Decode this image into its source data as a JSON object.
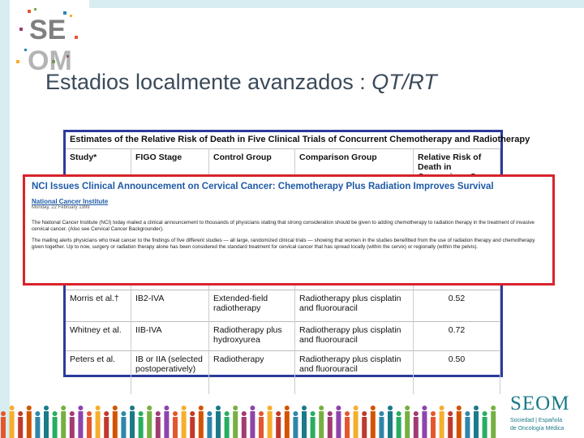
{
  "slide": {
    "title_main": "Estadios localmente avanzados : ",
    "title_italic": "QT/RT"
  },
  "logo": {
    "text": "SE OM"
  },
  "table": {
    "caption": "Estimates of the Relative Risk of Death in Five Clinical Trials of Concurrent Chemotherapy and Radiotherapy",
    "headers": [
      "Study*",
      "FIGO Stage",
      "Control Group",
      "Comparison Group",
      "Relative Risk of Death in Comparison Group"
    ],
    "rows": [
      [
        "Morris et al.†",
        "IB2-IVA",
        "Extended-field radiotherapy",
        "Radiotherapy plus cisplatin and fluorouracil",
        "0.52"
      ],
      [
        "Whitney et al.",
        "IIB-IVA",
        "Radiotherapy plus hydroxyurea",
        "Radiotherapy plus cisplatin and fluorouracil",
        "0.72"
      ],
      [
        "Peters et al.",
        "IB or IIA (selected postoperatively)",
        "Radiotherapy",
        "Radiotherapy plus cisplatin and fluorouracil",
        "0.50"
      ]
    ]
  },
  "announcement": {
    "title": "NCI Issues Clinical Announcement on Cervical Cancer: Chemotherapy Plus Radiation Improves Survival",
    "source": "National Cancer Institute",
    "date": "Monday, 22 February 1999",
    "para1": "The National Cancer Institute (NCI) today mailed a clinical announcement to thousands of physicians stating that strong consideration should be given to adding chemotherapy to radiation therapy in the treatment of invasive cervical cancer. (Also see Cervical Cancer Backgrounder).",
    "para2": "The mailing alerts physicians who treat cancer to the findings of five different studies — all large, randomized clinical trials — showing that women in the studies benefitted from the use of radiation therapy and chemotherapy given together. Up to now, surgery or radiation therapy alone has been considered the standard treatment for cervical cancer that has spread locally (within the cervix) or regionally (within the pelvis)."
  },
  "seom": {
    "word": "SEOM",
    "sub1": "Sociedad | Española",
    "sub2": "de Oncología Médica"
  },
  "colors": {
    "accent_red": "#d9232b",
    "frame_blue": "#2d3a9c",
    "seom_teal": "#1a7a88"
  }
}
